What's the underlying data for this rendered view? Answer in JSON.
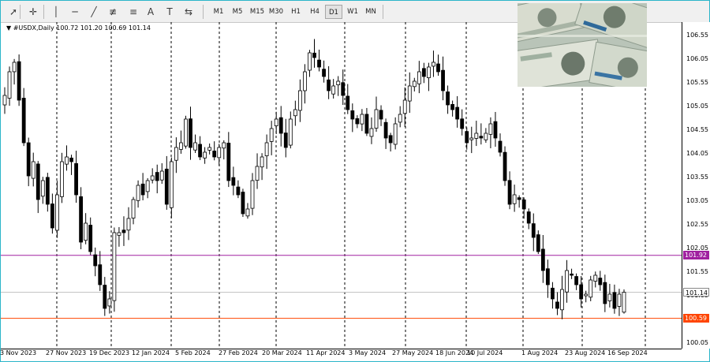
{
  "toolbar": {
    "tools": [
      {
        "name": "cursor-icon",
        "glyph": "➚"
      },
      {
        "name": "crosshair-icon",
        "glyph": "✛"
      },
      {
        "name": "vertical-line-icon",
        "glyph": "│"
      },
      {
        "name": "horizontal-line-icon",
        "glyph": "─"
      },
      {
        "name": "trendline-icon",
        "glyph": "╱"
      },
      {
        "name": "equidistant-channel-icon",
        "glyph": "≢"
      },
      {
        "name": "fibonacci-icon",
        "glyph": "≡"
      },
      {
        "name": "text-icon",
        "glyph": "A"
      },
      {
        "name": "text-label-icon",
        "glyph": "T"
      },
      {
        "name": "arrows-dropdown-icon",
        "glyph": "⇆"
      }
    ],
    "timeframes": [
      "M1",
      "M5",
      "M15",
      "M30",
      "H1",
      "H4",
      "D1",
      "W1",
      "MN"
    ],
    "active_timeframe": "D1"
  },
  "chart_header": {
    "symbol_text": "#USDX,Daily  100.72 101.20 100.69 101.14"
  },
  "price_axis": {
    "labels": [
      "106.55",
      "106.05",
      "105.55",
      "105.05",
      "104.55",
      "104.05",
      "103.55",
      "103.05",
      "102.55",
      "102.05",
      "101.55",
      "101.05",
      "100.55",
      "100.05"
    ],
    "current_price": "101.14",
    "resistance_price": "101.92",
    "support_price": "100.59"
  },
  "time_axis": {
    "labels": [
      "3 Nov 2023",
      "27 Nov 2023",
      "19 Dec 2023",
      "12 Jan 2024",
      "5 Feb 2024",
      "27 Feb 2024",
      "20 Mar 2024",
      "11 Apr 2024",
      "3 May 2024",
      "27 May 2024",
      "18 Jun 2024",
      "10 Jul 2024",
      "1 Aug 2024",
      "23 Aug 2024",
      "16 Sep 2024"
    ]
  },
  "colors": {
    "resistance_line": "#a020a0",
    "support_line": "#ff4500",
    "current_line": "#c0c0c0",
    "grid_dash": "#000000",
    "accent_frame": "#2bb5c9"
  },
  "chart_data": {
    "type": "candlestick",
    "symbol": "#USDX",
    "period": "Daily",
    "last": {
      "open": 100.72,
      "high": 101.2,
      "low": 100.69,
      "close": 101.14
    },
    "ylim": [
      99.95,
      106.85
    ],
    "horizontal_levels": [
      101.92,
      101.14,
      100.59
    ],
    "closes_approx": [
      105.3,
      105.8,
      106.0,
      105.2,
      104.3,
      103.6,
      103.9,
      103.1,
      103.5,
      103.0,
      102.5,
      103.2,
      103.9,
      104.0,
      103.9,
      103.2,
      102.2,
      102.6,
      102.0,
      101.7,
      101.3,
      100.8,
      101.0,
      102.4,
      102.4,
      102.4,
      102.7,
      103.1,
      103.4,
      103.2,
      103.5,
      103.6,
      103.5,
      103.7,
      103.0,
      103.9,
      104.2,
      104.3,
      104.8,
      104.2,
      104.3,
      104.0,
      104.1,
      104.2,
      104.0,
      104.2,
      104.3,
      103.5,
      103.4,
      103.2,
      102.8,
      102.9,
      103.5,
      103.8,
      104.0,
      104.3,
      104.6,
      104.8,
      104.5,
      104.2,
      104.8,
      105.0,
      105.4,
      105.8,
      106.2,
      106.1,
      105.9,
      105.7,
      105.4,
      105.5,
      105.6,
      105.3,
      105.0,
      104.8,
      104.7,
      104.9,
      104.5,
      104.6,
      105.0,
      104.8,
      104.4,
      104.3,
      104.7,
      104.9,
      105.2,
      105.5,
      105.6,
      105.8,
      105.7,
      105.9,
      106.0,
      105.8,
      105.4,
      105.1,
      105.0,
      104.8,
      104.6,
      104.3,
      104.4,
      104.5,
      104.4,
      104.5,
      104.7,
      104.4,
      104.1,
      103.5,
      103.0,
      103.2,
      103.1,
      102.9,
      102.6,
      102.3,
      102.0,
      101.6,
      101.3,
      101.0,
      100.8,
      101.2,
      101.6,
      101.5,
      101.3,
      101.0,
      101.1,
      101.4,
      101.5,
      101.3,
      100.9,
      101.1,
      100.8,
      101.1,
      101.14
    ]
  }
}
